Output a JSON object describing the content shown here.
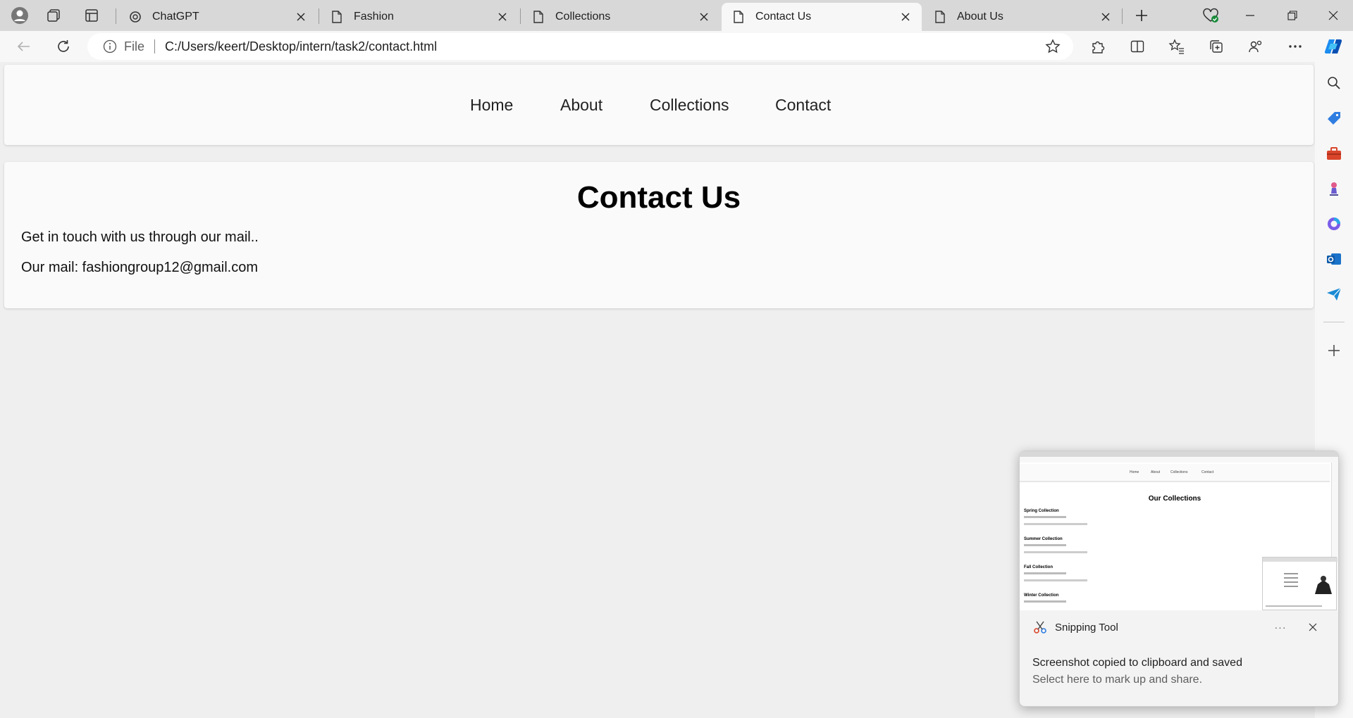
{
  "browser": {
    "tabs": [
      {
        "title": "ChatGPT",
        "icon": "chatgpt-icon",
        "active": false
      },
      {
        "title": "Fashion",
        "icon": "page-icon",
        "active": false
      },
      {
        "title": "Collections",
        "icon": "page-icon",
        "active": false
      },
      {
        "title": "Contact Us",
        "icon": "page-icon",
        "active": true
      },
      {
        "title": "About Us",
        "icon": "page-icon",
        "active": false
      }
    ],
    "address": {
      "scheme_label": "File",
      "url": "C:/Users/keert/Desktop/intern/task2/contact.html"
    },
    "accent_color": "#0f6cbd"
  },
  "page": {
    "nav": [
      "Home",
      "About",
      "Collections",
      "Contact"
    ],
    "heading": "Contact Us",
    "line1": "Get in touch with us through our mail..",
    "line2": "Our mail: fashiongroup12@gmail.com"
  },
  "toast": {
    "app_name": "Snipping Tool",
    "more_label": "···",
    "message": "Screenshot copied to clipboard and saved",
    "sub_message": "Select here to mark up and share.",
    "preview": {
      "nav": [
        "Home",
        "About",
        "Collections",
        "Contact"
      ],
      "title": "Our Collections",
      "sections": [
        "Spring Collection",
        "Summer Collection",
        "Fall Collection",
        "Winter Collection"
      ]
    }
  }
}
